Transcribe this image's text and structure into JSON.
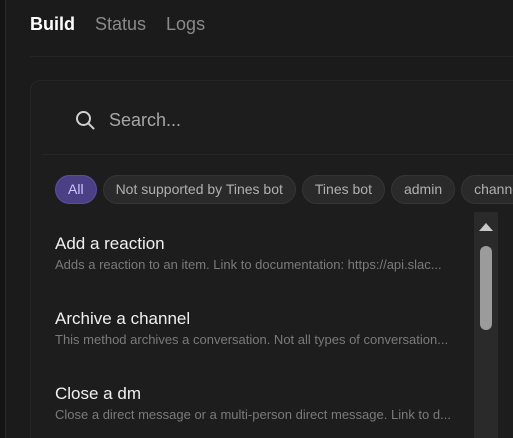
{
  "tabs": [
    {
      "label": "Build",
      "active": true
    },
    {
      "label": "Status",
      "active": false
    },
    {
      "label": "Logs",
      "active": false
    }
  ],
  "search": {
    "placeholder": "Search...",
    "icon": "search-icon"
  },
  "filters": [
    {
      "label": "All",
      "selected": true
    },
    {
      "label": "Not supported by Tines bot",
      "selected": false
    },
    {
      "label": "Tines bot",
      "selected": false
    },
    {
      "label": "admin",
      "selected": false
    },
    {
      "label": "channels",
      "selected": false
    }
  ],
  "actions": [
    {
      "title": "Add a reaction",
      "description": "Adds a reaction to an item. Link to documentation: https://api.slac..."
    },
    {
      "title": "Archive a channel",
      "description": "This method archives a conversation. Not all types of conversation..."
    },
    {
      "title": "Close a dm",
      "description": "Close a direct message or a multi-person direct message. Link to d..."
    }
  ],
  "colors": {
    "background": "#1b1b1b",
    "accent": "#4b3f86",
    "chip_bg": "#2a2a2a"
  }
}
